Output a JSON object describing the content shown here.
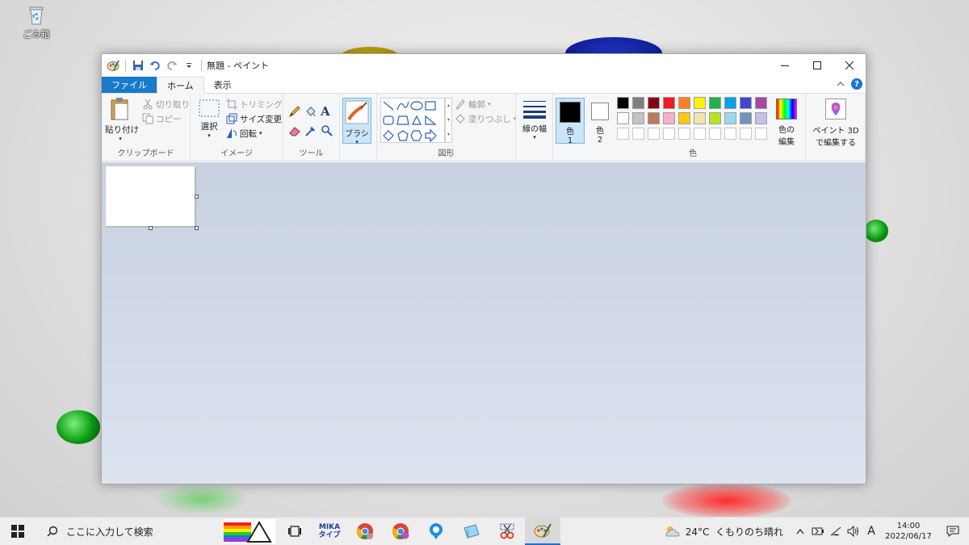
{
  "desktop": {
    "recycle_bin_label": "ごみ箱"
  },
  "window": {
    "title": "無題 - ペイント",
    "controls": {
      "minimize": "—",
      "maximize": "☐",
      "close": "✕"
    }
  },
  "tabs": {
    "file": "ファイル",
    "home": "ホーム",
    "view": "表示"
  },
  "help_label": "?",
  "ribbon": {
    "clipboard": {
      "paste": "貼り付け",
      "cut": "切り取り",
      "copy": "コピー",
      "group": "クリップボード"
    },
    "image": {
      "select": "選択",
      "crop": "トリミング",
      "resize": "サイズ変更",
      "rotate": "回転",
      "group": "イメージ"
    },
    "tools": {
      "text_glyph": "A",
      "group": "ツール"
    },
    "brush": {
      "label": "ブラシ"
    },
    "shapes": {
      "outline": "輪郭",
      "fill": "塗りつぶし",
      "group": "図形"
    },
    "size": {
      "label": "線の幅"
    },
    "color1": {
      "label": "色",
      "num": "1"
    },
    "color2": {
      "label": "色",
      "num": "2"
    },
    "colors": {
      "group": "色",
      "edit_line1": "色の",
      "edit_line2": "編集",
      "row1": [
        "#000000",
        "#7f7f7f",
        "#880015",
        "#ed1c24",
        "#ff7f27",
        "#fff200",
        "#22b14c",
        "#00a2e8",
        "#3f48cc",
        "#a349a4"
      ],
      "row2": [
        "#ffffff",
        "#c3c3c3",
        "#b97a57",
        "#ffaec9",
        "#ffc90e",
        "#efe4b0",
        "#b5e61d",
        "#99d9ea",
        "#7092be",
        "#c8bfe7"
      ]
    },
    "paint3d": {
      "line1": "ペイント 3D",
      "line2": "で編集する"
    }
  },
  "taskbar": {
    "search_placeholder": "ここに入力して検索",
    "mika_line1": "MIKA",
    "mika_line2": "タイプ",
    "weather": "24°C  くもりのち晴れ",
    "ime": "A",
    "time": "14:00",
    "date": "2022/06/17"
  }
}
